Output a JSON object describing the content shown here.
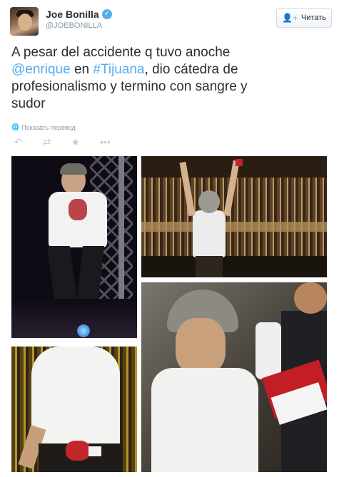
{
  "user": {
    "name": "Joe Bonilla",
    "handle": "@JOEBONILLA"
  },
  "follow_button": {
    "label": "Читать"
  },
  "tweet": {
    "text_part1": "A pesar del accidente q tuvo anoche\n",
    "mention": "@enrique",
    "text_part2": " en ",
    "hashtag": "#Tijuana",
    "text_part3": ", dio cátedra de\nprofesionalismo y termino con sangre y\nsudor"
  },
  "translate_label": "Показать перевод",
  "actions": [
    "reply-icon",
    "retweet-icon",
    "favorite-icon",
    "more-icon"
  ],
  "colors": {
    "link": "#55acee",
    "text": "#292f33",
    "muted": "#8899a6"
  }
}
